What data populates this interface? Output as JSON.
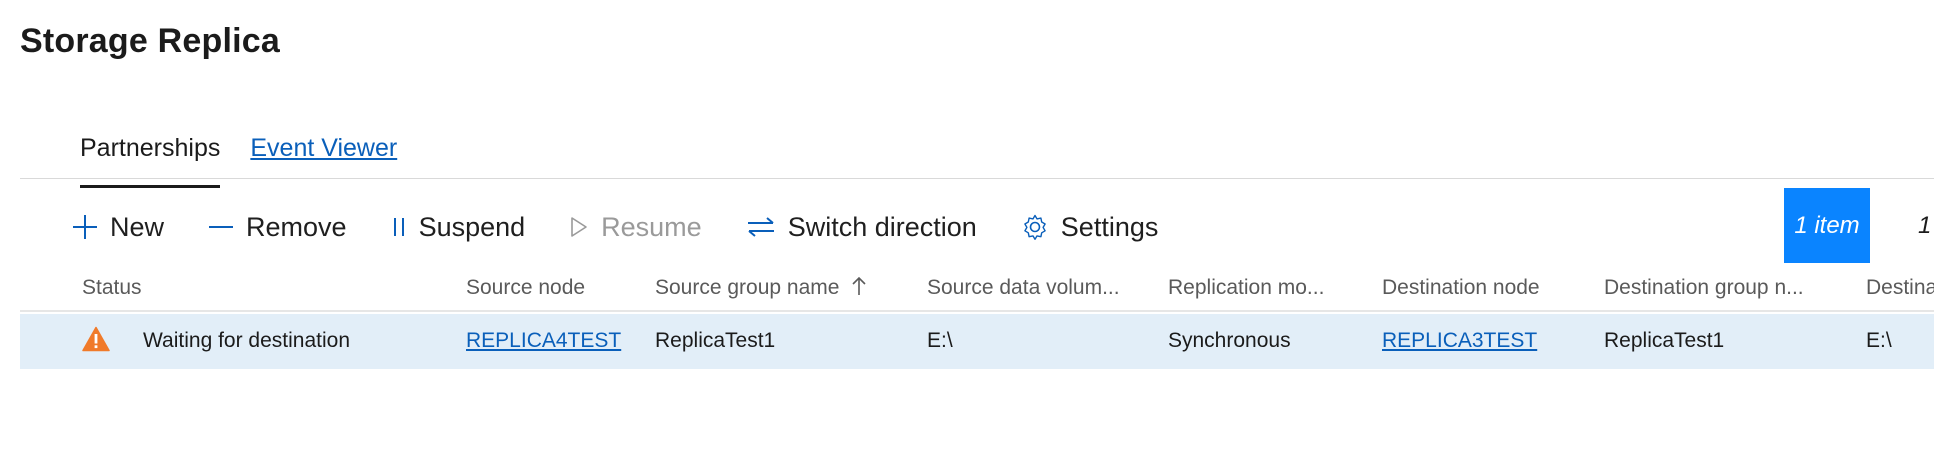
{
  "page": {
    "title": "Storage Replica"
  },
  "tabs": [
    {
      "label": "Partnerships",
      "active": true
    },
    {
      "label": "Event Viewer",
      "active": false
    }
  ],
  "toolbar": {
    "new_label": "New",
    "remove_label": "Remove",
    "suspend_label": "Suspend",
    "resume_label": "Resume",
    "switch_label": "Switch direction",
    "settings_label": "Settings",
    "item_count": "1 item",
    "overflow_text": "1"
  },
  "grid": {
    "columns": [
      "Status",
      "Source node",
      "Source group name",
      "Source data volum...",
      "Replication mo...",
      "Destination node",
      "Destination group n...",
      "Destina"
    ],
    "sorted_column": "Source group name",
    "rows": [
      {
        "status": "Waiting for destination",
        "source_node": "REPLICA4TEST",
        "source_group": "ReplicaTest1",
        "source_volume": "E:\\",
        "replication_mode": "Synchronous",
        "destination_node": "REPLICA3TEST",
        "destination_group": "ReplicaTest1",
        "destination_volume": "E:\\"
      }
    ]
  },
  "icons": {
    "new": "plus-icon",
    "remove": "minus-icon",
    "suspend": "pause-icon",
    "resume": "play-icon",
    "switch": "swap-arrows-icon",
    "settings": "gear-icon",
    "status_warning": "warning-triangle-icon",
    "sort": "sort-up-arrow-icon"
  },
  "colors": {
    "accent": "#0a84ff",
    "link": "#0a5fba",
    "selected_row": "#e2eef8",
    "warning": "#f07a2a"
  }
}
